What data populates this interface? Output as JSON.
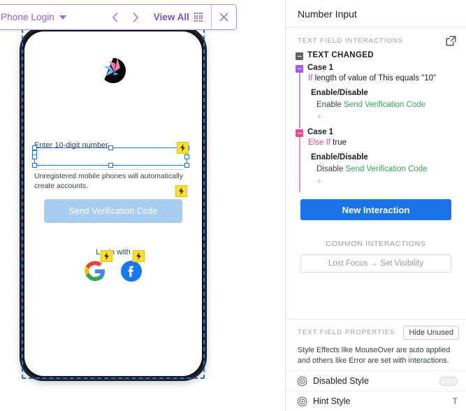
{
  "toolbar": {
    "screen_name": "Phone Login",
    "dropdown_icon": "caret-down-icon",
    "prev_icon": "chevron-left-icon",
    "next_icon": "chevron-right-icon",
    "view_all_label": "View All",
    "grid_icon": "grid-icon",
    "close_icon": "close-icon",
    "accent": "#8c5fd8"
  },
  "phone": {
    "logo_icon": "app-logo-icon",
    "field_label": "Enter 10-digit number",
    "field_value": "",
    "helper_text": "Unregistered mobile phones will automatically create accounts.",
    "cta_label": "Send Verification Code",
    "cta_color": "#a8cdf0",
    "login_with_label": "Login with",
    "social": [
      {
        "name": "google-login-icon",
        "badge": "interaction-bolt-icon"
      },
      {
        "name": "facebook-login-icon",
        "badge": "interaction-bolt-icon"
      }
    ],
    "selection_color": "#1a73e8",
    "badge_color": "#ffe028"
  },
  "panel": {
    "header_title": "Number Input",
    "interactions_section": {
      "label": "TEXT FIELD INTERACTIONS",
      "expand_icon": "external-link-icon",
      "event": {
        "toggle_icon": "collapse-minus-icon",
        "name": "TEXT CHANGED"
      },
      "cases": [
        {
          "toggle_icon": "collapse-minus-icon",
          "title": "Case 1",
          "keyword": "If",
          "condition": "length of value of This equals \"10\"",
          "accent": "#a855f7",
          "group": "Enable/Disable",
          "action_verb": "Enable",
          "action_target": "Send Verification Code",
          "add_icon": "+"
        },
        {
          "toggle_icon": "collapse-minus-icon",
          "title": "Case 1",
          "keyword": "Else If",
          "condition": "true",
          "accent": "#ec4899",
          "group": "Enable/Disable",
          "action_verb": "Disable",
          "action_target": "Send Verification Code",
          "add_icon": "+"
        }
      ]
    },
    "new_interaction_label": "New Interaction",
    "new_interaction_color": "#1a73e8",
    "common_interactions_label": "COMMON INTERACTIONS",
    "common_interaction_chip": "Lost Focus → Set Visibility",
    "properties_section": {
      "label": "TEXT FIELD PROPERTIES",
      "hide_unused_label": "Hide Unused",
      "note": "Style Effects like MouseOver are auto applied and others like Error are set with interactions.",
      "rows": [
        {
          "icon": "style-target-icon",
          "name": "Disabled Style",
          "control": "toggle-pill"
        },
        {
          "icon": "style-target-icon",
          "name": "Hint Style",
          "control": "T"
        }
      ]
    }
  }
}
